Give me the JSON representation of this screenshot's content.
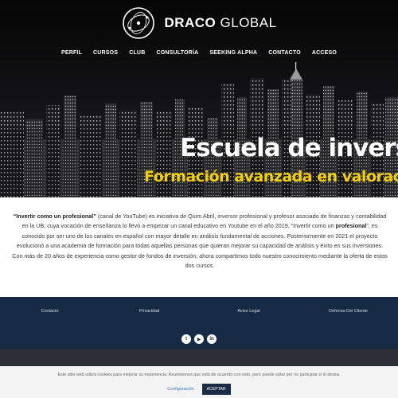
{
  "brand": {
    "name_bold": "DRACO",
    "name_light": "GLOBAL"
  },
  "nav": [
    "PERFIL",
    "CURSOS",
    "CLUB",
    "CONSULTORÍA",
    "SEEKING ALPHA",
    "CONTACTO",
    "ACCESO"
  ],
  "hero": {
    "title": "Escuela de inversi",
    "subtitle": "Formación avanzada en valoración"
  },
  "intro": {
    "quote1": "“Invertir como un profesional”",
    "text1": " (canal de YouTube) es iniciativa de Quim Abril, inversor profesional y profesor asociado de finanzas y contabilidad en la UB; cuya vocación de enseñanza lo llevó a empezar un canal educativo en Youtube en el año 2019. “Invertir como un ",
    "quote2": "profesional",
    "text2": "”, es conocido por ser uno de los canales en español con mayor detalle en análisis fundamental de acciones. Posteriormente en 2021 el proyecto evolucionó a una academia de formación para todas aquellas personas que quieran mejorar su capacidad de análisis y éxito en sus inversiones. Con más de 20 años de experiencia como gestor de fondos de inversión, ahora compartimos todo nuestro conocimiento mediante la oferta de estos dos cursos."
  },
  "footer": {
    "links": [
      "Contacto",
      "Privacidad",
      "Aviso Legal",
      "Defensa Del Cliente"
    ],
    "socials": [
      {
        "icon": "twitter-icon",
        "glyph": "t"
      },
      {
        "icon": "youtube-icon",
        "glyph": "▶"
      },
      {
        "icon": "linkedin-icon",
        "glyph": "in"
      }
    ]
  },
  "cookie": {
    "text": "Este sitio web utiliza cookies para mejorar su experiencia. Asumiremos que está de acuerdo con esto, pero puede optar por no participar si lo desea.",
    "config": "Configuración",
    "accept": "ACEPTAR"
  },
  "colors": {
    "accent_yellow": "#f5d100",
    "footer_navy": "#162a44",
    "accept_button": "#1a2b45"
  }
}
